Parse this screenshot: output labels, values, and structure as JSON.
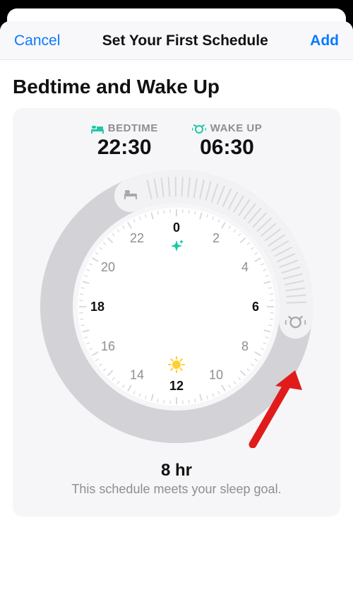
{
  "nav": {
    "cancel": "Cancel",
    "title": "Set Your First Schedule",
    "add": "Add"
  },
  "heading": "Bedtime and Wake Up",
  "bedtime": {
    "label": "BEDTIME",
    "value": "22:30",
    "hour24": 22.5
  },
  "wakeup": {
    "label": "WAKE UP",
    "value": "06:30",
    "hour24": 6.5
  },
  "clock": {
    "hours": [
      "0",
      "2",
      "4",
      "6",
      "8",
      "10",
      "12",
      "14",
      "16",
      "18",
      "20",
      "22"
    ],
    "strong_hours": [
      "0",
      "6",
      "12",
      "18"
    ]
  },
  "summary": {
    "duration": "8 hr",
    "note": "This schedule meets your sleep goal."
  },
  "colors": {
    "accent_teal": "#1fc7a7",
    "ios_blue": "#0a7aff",
    "gray_track": "#c9c9cf",
    "arc_fill": "#f0f0f2",
    "arrow_red": "#e11b1b"
  }
}
